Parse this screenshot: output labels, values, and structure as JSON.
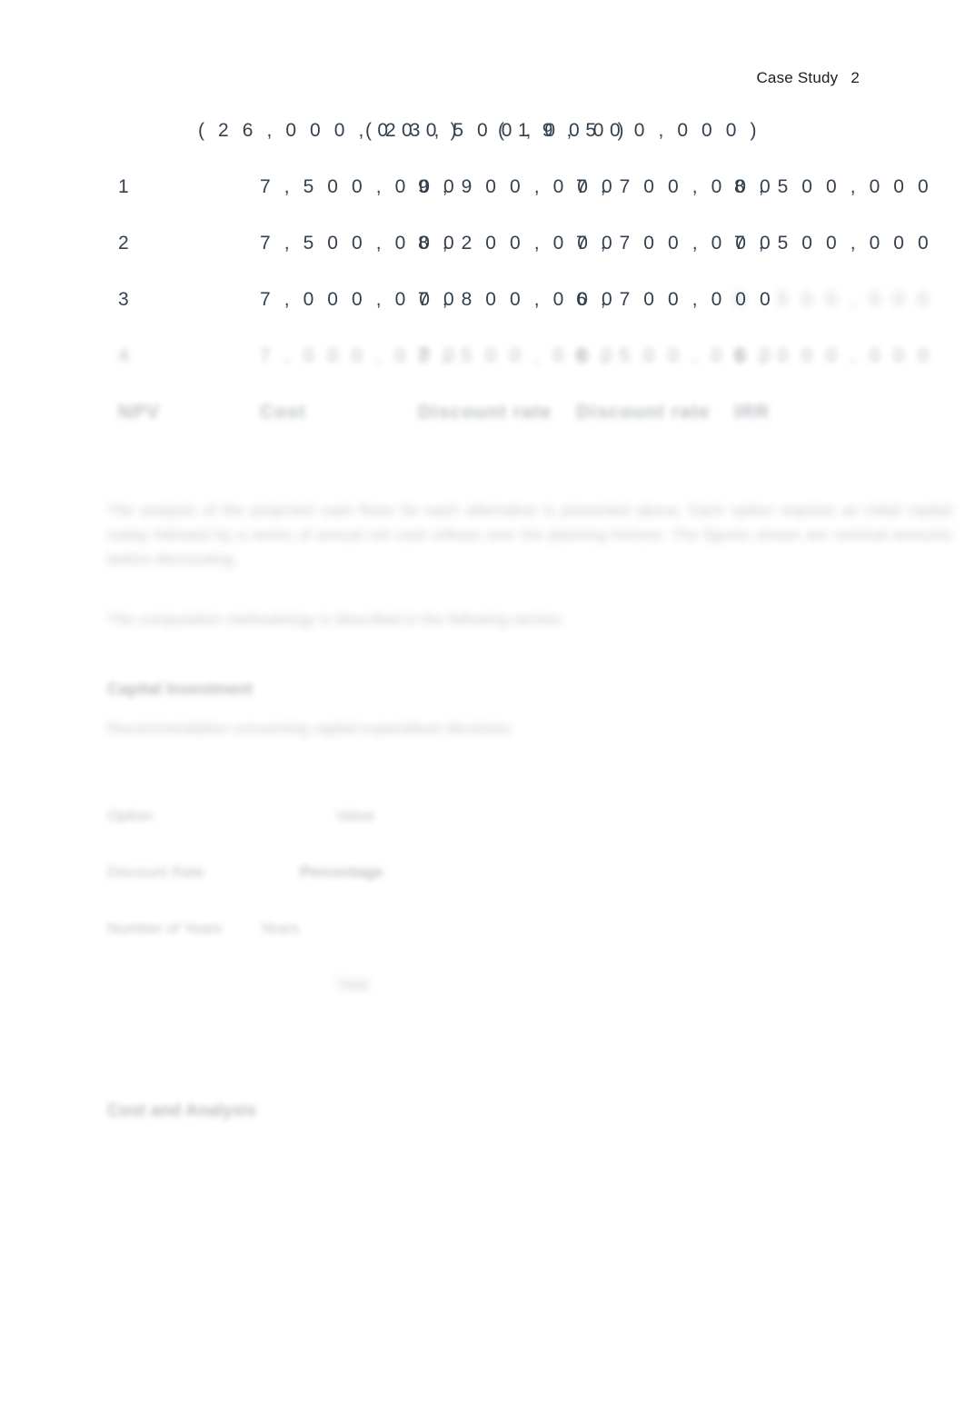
{
  "document": {
    "header": {
      "title": "Case Study",
      "page_number": "2"
    },
    "table": {
      "overlap_row": {
        "segment_a": "( 2 6 , 0 0 0 , 0 0 0 )",
        "segment_b": "( 2 3 , 5 0 0 , 0 0 0 )",
        "segment_c": "( 1 9 , 5 0 0 , 0 0 0 )"
      },
      "rows": [
        {
          "index": "1",
          "values": [
            "7 , 5 0 0 , 0 0 0",
            "9 , 9 0 0 , 0 0 0",
            "7 , 7 0 0 , 0 0 0",
            "8 , 5 0 0 , 0 0 0"
          ]
        },
        {
          "index": "2",
          "values": [
            "7 , 5 0 0 , 0 0 0",
            "8 , 2 0 0 , 0 0 0",
            "7 , 7 0 0 , 0 0 0",
            "7 , 5 0 0 , 0 0 0"
          ]
        },
        {
          "index": "3",
          "values": [
            "7 , 0 0 0 , 0 0 0",
            "7 , 8 0 0 , 0 0 0",
            "6 , 7 0 0 , 0 0 0",
            "6 , 5 0 0 , 0 0 0"
          ]
        },
        {
          "index": "4",
          "values": [
            "7 , 0 0 0 , 0 0 0",
            "7 , 5 0 0 , 0 0 0",
            "6 , 5 0 0 , 0 0 0",
            "6 , 0 0 0 , 0 0 0"
          ]
        }
      ],
      "total_row": {
        "index": "NPV",
        "label": "Cost",
        "values": [
          "Discount rate",
          "Discount rate",
          "IRR"
        ]
      }
    },
    "body": {
      "paragraph_1": "The analysis of the projected cash flows for each alternative is presented above. Each option requires an initial capital outlay followed by a series of annual net cash inflows over the planning horizon. The figures shown are nominal amounts before discounting.",
      "paragraph_2": "The computation methodology is described in the following section.",
      "heading_1": "Capital Investment",
      "sub_line_1": "Recommendation concerning capital expenditure decisions",
      "details": [
        {
          "key": "Option",
          "value": "Value"
        },
        {
          "key": "Discount Rate",
          "value": "Percentage"
        },
        {
          "key": "Number of Years",
          "value": "Years"
        },
        {
          "key": "",
          "value": "Total"
        }
      ],
      "heading_2": "Cost and Analysis"
    }
  }
}
